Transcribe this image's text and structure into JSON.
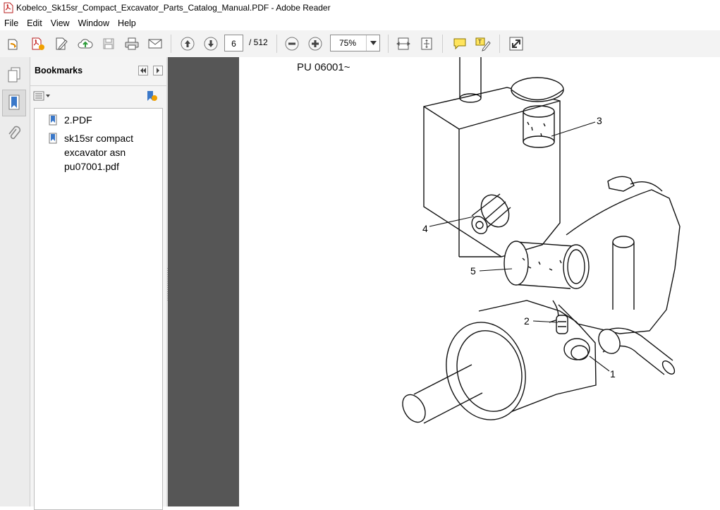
{
  "window": {
    "title": "Kobelco_Sk15sr_Compact_Excavator_Parts_Catalog_Manual.PDF - Adobe Reader"
  },
  "menu": [
    "File",
    "Edit",
    "View",
    "Window",
    "Help"
  ],
  "toolbar": {
    "current_page": "6",
    "page_total": "/  512",
    "zoom": "75%"
  },
  "bookmarks": {
    "title": "Bookmarks",
    "items": [
      {
        "label": "2.PDF"
      },
      {
        "label": "sk15sr compact excavator asn pu07001.pdf"
      }
    ]
  },
  "document": {
    "header_text": "PU 06001~",
    "callouts": [
      "3",
      "4",
      "5",
      "2",
      "1"
    ]
  },
  "colors": {
    "toolbar_bg": "#f3f3f3",
    "doc_bg": "#565656",
    "accent_blue": "#3a78c9"
  }
}
